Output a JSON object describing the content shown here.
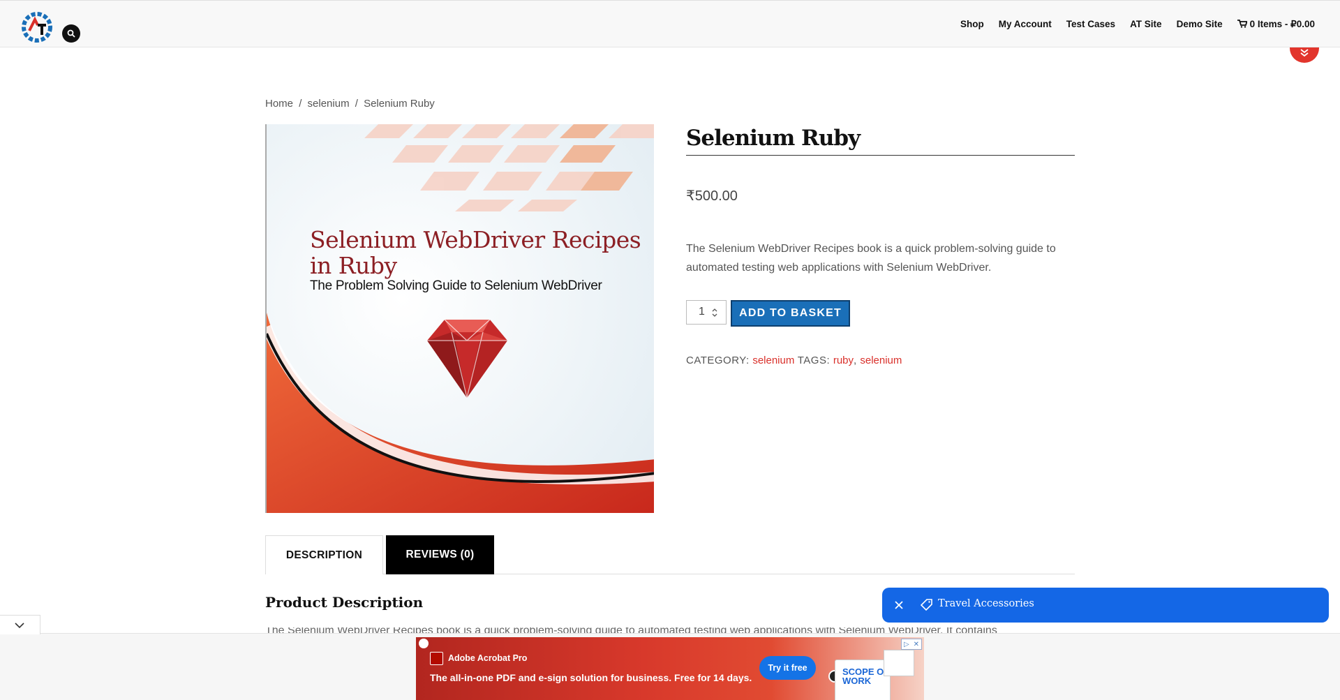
{
  "header": {
    "nav": [
      "Shop",
      "My Account",
      "Test Cases",
      "AT Site",
      "Demo Site"
    ],
    "cart_label": "0 Items - ₽0.00"
  },
  "breadcrumb": {
    "home": "Home",
    "category": "selenium",
    "current": "Selenium Ruby",
    "separator": "/"
  },
  "product": {
    "title": "Selenium Ruby",
    "price": "₹500.00",
    "short_description": "The Selenium WebDriver Recipes book is a quick problem-solving guide to automated testing web applications with Selenium WebDriver.",
    "quantity": "1",
    "add_button": "ADD TO BASKET",
    "category_label": "CATEGORY:",
    "category": "selenium",
    "tags_label": "TAGS:",
    "tags": [
      "ruby",
      "selenium"
    ],
    "cover": {
      "title_line1": "Selenium WebDriver Recipes",
      "title_line2": "in Ruby",
      "subtitle": "The Problem Solving Guide to Selenium WebDriver"
    }
  },
  "tabs": {
    "description": "DESCRIPTION",
    "reviews": "REVIEWS (0)"
  },
  "description_section": {
    "title": "Product Description",
    "text_cut": "The Selenium WebDriver Recipes book is a quick problem-solving guide to automated testing web applications with Selenium WebDriver. It contains"
  },
  "travel_pill": {
    "label": "Travel Accessories"
  },
  "ad": {
    "brand": "Adobe Acrobat Pro",
    "headline": "The all-in-one PDF and e-sign solution for business. Free for 14 days.",
    "cta": "Try it free",
    "doc_title": "SCOPE OF WORK"
  },
  "colors": {
    "accent_red": "#d9302a",
    "button_blue": "#1a6fb8",
    "pill_blue": "#1467e6"
  }
}
